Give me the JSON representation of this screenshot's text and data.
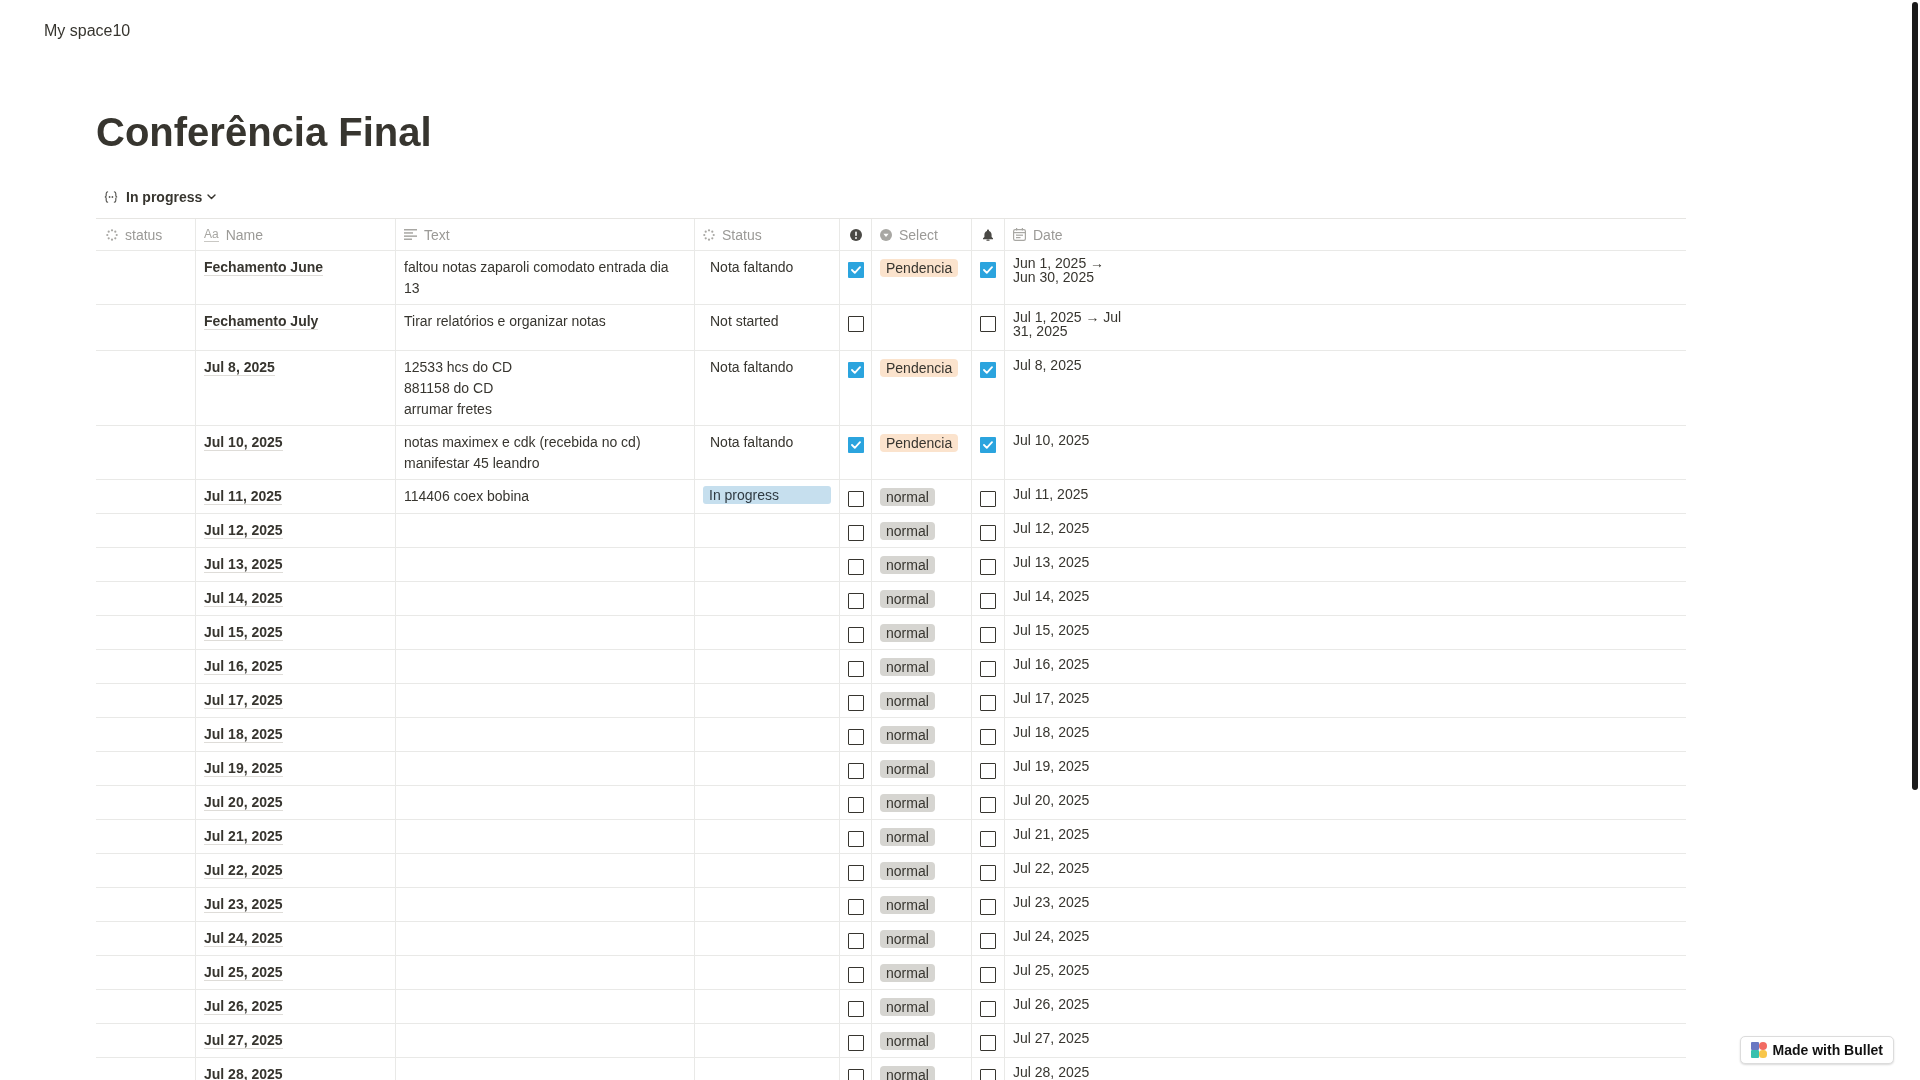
{
  "workspace": {
    "title": "My space10"
  },
  "page": {
    "title": "Conferência Final"
  },
  "view": {
    "label": "In progress"
  },
  "table": {
    "columns": [
      {
        "kind": "status",
        "label": "status"
      },
      {
        "kind": "title",
        "label": "Name",
        "glyph": "Aa"
      },
      {
        "kind": "text",
        "label": "Text"
      },
      {
        "kind": "status",
        "label": "Status"
      },
      {
        "kind": "checkbox"
      },
      {
        "kind": "select",
        "label": "Select"
      },
      {
        "kind": "checkbox"
      },
      {
        "kind": "date",
        "label": "Date"
      }
    ],
    "rows": [
      {
        "name": "Fechamento June",
        "text": "faltou notas zaparoli comodato entrada dia 13",
        "status": {
          "label": "Nota faltando"
        },
        "column_5": {
          "checked": true
        },
        "select": {
          "label": "Pendencia",
          "color": "#fbe3cd"
        },
        "column_7": {
          "checked": true
        },
        "date": "Jun 1, 2025 → Jun 30, 2025"
      },
      {
        "name": "Fechamento July",
        "text": "Tirar relatórios e organizar notas",
        "status": {
          "label": "Not started"
        },
        "column_5": {
          "checked": false
        },
        "column_7": {
          "checked": false
        },
        "date": "Jul 1, 2025 → Jul 31, 2025"
      },
      {
        "name": "Jul 8, 2025",
        "text": "12533 hcs do CD\n881158 do CD\narrumar fretes",
        "status": {
          "label": "Nota faltando"
        },
        "column_5": {
          "checked": true
        },
        "select": {
          "label": "Pendencia",
          "color": "#fbe3cd"
        },
        "column_7": {
          "checked": true
        },
        "date": "Jul 8, 2025"
      },
      {
        "name": "Jul 10, 2025",
        "text": "notas maximex e cdk (recebida no cd)\nmanifestar 45 leandro",
        "status": {
          "label": "Nota faltando"
        },
        "column_5": {
          "checked": true
        },
        "select": {
          "label": "Pendencia",
          "color": "#fbe3cd"
        },
        "column_7": {
          "checked": true
        },
        "date": "Jul 10, 2025"
      },
      {
        "name": "Jul 11, 2025",
        "text": "114406 coex bobina",
        "status": {
          "label": "In progress",
          "color": "#c6dfee"
        },
        "column_5": {
          "checked": false
        },
        "select": {
          "label": "normal",
          "color": "#d6d5d1"
        },
        "column_7": {
          "checked": false
        },
        "date": "Jul 11, 2025"
      },
      {
        "name": "Jul 12, 2025",
        "column_5": {
          "checked": false
        },
        "select": {
          "label": "normal",
          "color": "#d6d5d1"
        },
        "column_7": {
          "checked": false
        },
        "date": "Jul 12, 2025"
      },
      {
        "name": "Jul 13, 2025",
        "column_5": {
          "checked": false
        },
        "select": {
          "label": "normal",
          "color": "#d6d5d1"
        },
        "column_7": {
          "checked": false
        },
        "date": "Jul 13, 2025"
      },
      {
        "name": "Jul 14, 2025",
        "column_5": {
          "checked": false
        },
        "select": {
          "label": "normal",
          "color": "#d6d5d1"
        },
        "column_7": {
          "checked": false
        },
        "date": "Jul 14, 2025"
      },
      {
        "name": "Jul 15, 2025",
        "column_5": {
          "checked": false
        },
        "select": {
          "label": "normal",
          "color": "#d6d5d1"
        },
        "column_7": {
          "checked": false
        },
        "date": "Jul 15, 2025"
      },
      {
        "name": "Jul 16, 2025",
        "column_5": {
          "checked": false
        },
        "select": {
          "label": "normal",
          "color": "#d6d5d1"
        },
        "column_7": {
          "checked": false
        },
        "date": "Jul 16, 2025"
      },
      {
        "name": "Jul 17, 2025",
        "column_5": {
          "checked": false
        },
        "select": {
          "label": "normal",
          "color": "#d6d5d1"
        },
        "column_7": {
          "checked": false
        },
        "date": "Jul 17, 2025"
      },
      {
        "name": "Jul 18, 2025",
        "column_5": {
          "checked": false
        },
        "select": {
          "label": "normal",
          "color": "#d6d5d1"
        },
        "column_7": {
          "checked": false
        },
        "date": "Jul 18, 2025"
      },
      {
        "name": "Jul 19, 2025",
        "column_5": {
          "checked": false
        },
        "select": {
          "label": "normal",
          "color": "#d6d5d1"
        },
        "column_7": {
          "checked": false
        },
        "date": "Jul 19, 2025"
      },
      {
        "name": "Jul 20, 2025",
        "column_5": {
          "checked": false
        },
        "select": {
          "label": "normal",
          "color": "#d6d5d1"
        },
        "column_7": {
          "checked": false
        },
        "date": "Jul 20, 2025"
      },
      {
        "name": "Jul 21, 2025",
        "column_5": {
          "checked": false
        },
        "select": {
          "label": "normal",
          "color": "#d6d5d1"
        },
        "column_7": {
          "checked": false
        },
        "date": "Jul 21, 2025"
      },
      {
        "name": "Jul 22, 2025",
        "column_5": {
          "checked": false
        },
        "select": {
          "label": "normal",
          "color": "#d6d5d1"
        },
        "column_7": {
          "checked": false
        },
        "date": "Jul 22, 2025"
      },
      {
        "name": "Jul 23, 2025",
        "column_5": {
          "checked": false
        },
        "select": {
          "label": "normal",
          "color": "#d6d5d1"
        },
        "column_7": {
          "checked": false
        },
        "date": "Jul 23, 2025"
      },
      {
        "name": "Jul 24, 2025",
        "column_5": {
          "checked": false
        },
        "select": {
          "label": "normal",
          "color": "#d6d5d1"
        },
        "column_7": {
          "checked": false
        },
        "date": "Jul 24, 2025"
      },
      {
        "name": "Jul 25, 2025",
        "column_5": {
          "checked": false
        },
        "select": {
          "label": "normal",
          "color": "#d6d5d1"
        },
        "column_7": {
          "checked": false
        },
        "date": "Jul 25, 2025"
      },
      {
        "name": "Jul 26, 2025",
        "column_5": {
          "checked": false
        },
        "select": {
          "label": "normal",
          "color": "#d6d5d1"
        },
        "column_7": {
          "checked": false
        },
        "date": "Jul 26, 2025"
      },
      {
        "name": "Jul 27, 2025",
        "column_5": {
          "checked": false
        },
        "select": {
          "label": "normal",
          "color": "#d6d5d1"
        },
        "column_7": {
          "checked": false
        },
        "date": "Jul 27, 2025"
      },
      {
        "name": "Jul 28, 2025",
        "column_5": {
          "checked": false
        },
        "select": {
          "label": "normal",
          "color": "#d6d5d1"
        },
        "column_7": {
          "checked": false
        },
        "date": "Jul 28, 2025"
      }
    ]
  },
  "badge": {
    "label": "Made with Bullet"
  }
}
